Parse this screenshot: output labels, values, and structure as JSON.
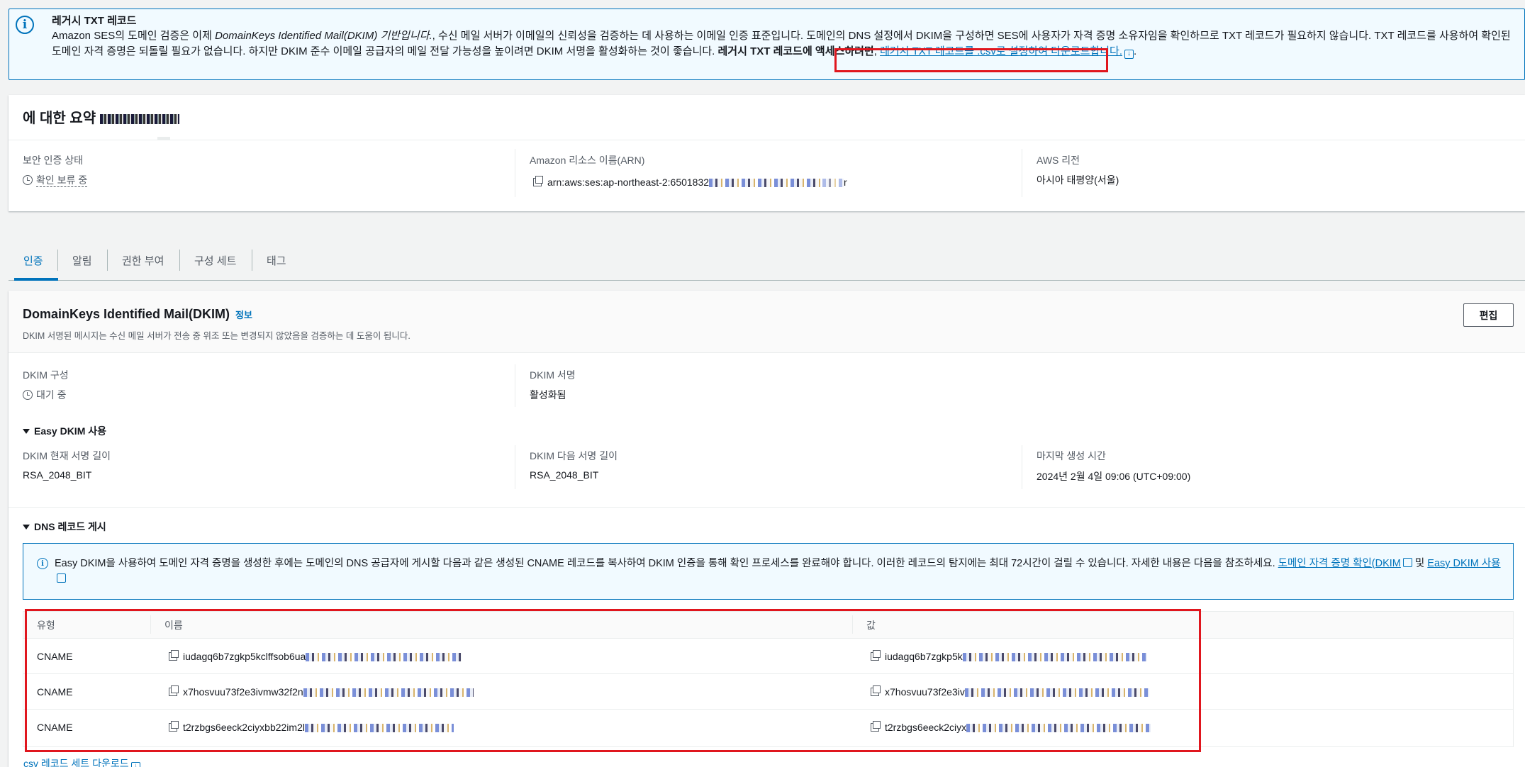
{
  "banner": {
    "title": "레거시 TXT 레코드",
    "text_1": "Amazon SES의 도메인 검증은 이제 ",
    "text_em": "DomainKeys Identified Mail(DKIM) 기반입니다.",
    "text_2": ", 수신 메일 서버가 이메일의 신뢰성을 검증하는 데 사용하는 이메일 인증 표준입니다. 도메인의 DNS 설정에서 DKIM을 구성하면 SES에 사용자가 자격 증명 소유자임을 확인하므로 TXT 레코드가 필요하지 않습니다. TXT 레코드를 사용하여 확인된 도메인 자격 증명은 되돌릴 필요가 없습니다. 하지만 DKIM 준수 이메일 공급자의 메일 전달 가능성을 높이려면 DKIM 서명을 활성화하는 것이 좋습니다. ",
    "text_bold": "레거시 TXT 레코드에 액세스하려면",
    "text_3": ", ",
    "link": "레거시 TXT 레코드를 .csv로 설정하여 다운로드합니다.",
    "text_end": "."
  },
  "summary": {
    "title_prefix": "에 대한 요약",
    "verification_label": "보안 인증 상태",
    "verification_value": "확인 보류 중",
    "arn_label": "Amazon 리소스 이름(ARN)",
    "arn_value": "arn:aws:ses:ap-northeast-2:6501832",
    "arn_suffix": "r",
    "region_label": "AWS 리전",
    "region_value": "아시아 태평양(서울)"
  },
  "tabs": [
    "인증",
    "알림",
    "권한 부여",
    "구성 세트",
    "태그"
  ],
  "dkim": {
    "title": "DomainKeys Identified Mail(DKIM)",
    "info": "정보",
    "description": "DKIM 서명된 메시지는 수신 메일 서버가 전송 중 위조 또는 변경되지 않았음을 검증하는 데 도움이 됩니다.",
    "edit_button": "편집",
    "config_label": "DKIM 구성",
    "config_value": "대기 중",
    "signing_label": "DKIM 서명",
    "signing_value": "활성화됨",
    "easy_toggle": "Easy DKIM 사용",
    "current_len_label": "DKIM 현재 서명 길이",
    "current_len_value": "RSA_2048_BIT",
    "next_len_label": "DKIM 다음 서명 길이",
    "next_len_value": "RSA_2048_BIT",
    "last_gen_label": "마지막 생성 시간",
    "last_gen_value": "2024년 2월 4일 09:06 (UTC+09:00)",
    "dns_toggle": "DNS 레코드 게시",
    "info2_text": "Easy DKIM을 사용하여 도메인 자격 증명을 생성한 후에는 도메인의 DNS 공급자에 게시할 다음과 같은 생성된 CNAME 레코드를 복사하여 DKIM 인증을 통해 확인 프로세스를 완료해야 합니다. 이러한 레코드의 탐지에는 최대 72시간이 걸릴 수 있습니다. 자세한 내용은 다음을 참조하세요. ",
    "info2_link1": "도메인 자격 증명 확인(DKIM",
    "info2_and": " 및 ",
    "info2_link2": "Easy DKIM 사용",
    "table": {
      "headers": [
        "유형",
        "이름",
        "값"
      ],
      "rows": [
        {
          "type": "CNAME",
          "name": "iudagq6b7zgkp5kclffsob6ua",
          "value": "iudagq6b7zgkp5k"
        },
        {
          "type": "CNAME",
          "name": "x7hosvuu73f2e3ivmw32f2n",
          "value": "x7hosvuu73f2e3iv"
        },
        {
          "type": "CNAME",
          "name": "t2rzbgs6eeck2ciyxbb22im2l",
          "value": "t2rzbgs6eeck2ciyx"
        }
      ]
    },
    "csv_link": "csv 레코드 세트 다운로드"
  },
  "colors": {
    "accent": "#0073bb",
    "highlight_box": "#e0161e",
    "page_bg": "#f2f3f3"
  }
}
